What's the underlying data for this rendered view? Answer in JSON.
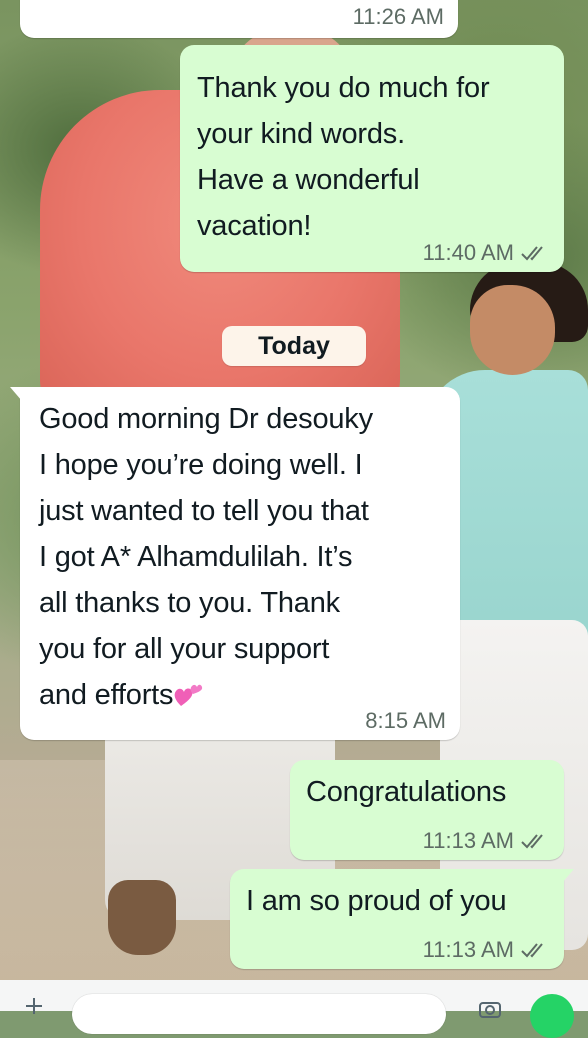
{
  "chat": {
    "messages": [
      {
        "direction": "in",
        "text": "",
        "time": "11:26 AM"
      },
      {
        "direction": "out",
        "text": "Thank you do much for\nyour kind words.\nHave a wonderful\nvacation!",
        "time": "11:40 AM",
        "status": "read"
      },
      {
        "direction": "in",
        "text": "Good morning Dr desouky\nI hope you’re doing well. I\njust wanted to tell you that\nI got A* Alhamdulilah. It’s\nall thanks to you. Thank\nyou for all your support\nand efforts",
        "emoji": "two-hearts-icon",
        "time": "8:15 AM"
      },
      {
        "direction": "out",
        "text": "Congratulations",
        "time": "11:13 AM",
        "status": "read"
      },
      {
        "direction": "out",
        "text": "I am so proud of you",
        "time": "11:13 AM",
        "status": "read"
      }
    ],
    "date_separator": "Today"
  },
  "colors": {
    "incoming_bubble": "#ffffff",
    "outgoing_bubble": "#d8fdd2",
    "read_ticks": "#5d6b64",
    "date_pill": "#fdf4ea",
    "send_button": "#25d366"
  }
}
